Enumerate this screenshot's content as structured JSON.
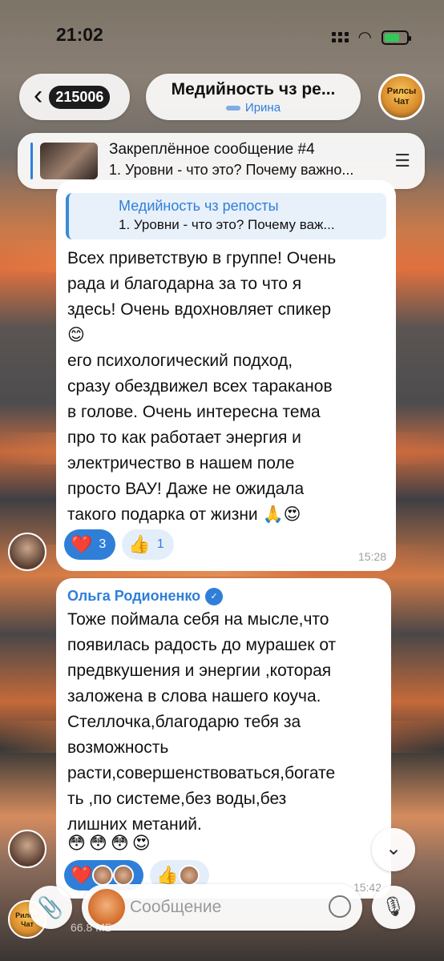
{
  "status": {
    "time": "21:02"
  },
  "header": {
    "back_badge": "215006",
    "title": "Медийность чз ре...",
    "subtitle": "Ирина",
    "avatar_text": "Рилсы Чат"
  },
  "pinned": {
    "title": "Закреплённое сообщение #4",
    "text": "1. Уровни - что это? Почему важно..."
  },
  "messages": [
    {
      "quote_title": "Медийность чз репосты",
      "quote_text": "1. Уровни - что это? Почему важ...",
      "text": "Всех приветствую в группе! Очень\nрада и благодарна за то что я\nздесь! Очень вдохновляет спикер\n😊\nего психологический подход,\nсразу обездвижел всех тараканов\nв голове. Очень интересна тема\nпро то как работает энергия и\nэлектричество в нашем поле\nпросто ВАУ! Даже не ожидала\nтакого подарка от жизни 🙏😍",
      "reactions": [
        {
          "emoji": "❤️",
          "count": "3"
        },
        {
          "emoji": "👍",
          "count": "1"
        }
      ],
      "time": "15:28"
    },
    {
      "sender": "Ольга Родионенко",
      "text": "Тоже поймала себя на мысле,что\nпоявилась радость до мурашек от\nпредвкушения и энергии ,которая\nзаложена в слова нашего коуча.\nСтеллочка,благодарю тебя за\nвозможность\nрасти,совершенствоваться,богате\nть ,по системе,без воды,без\nлишних метаний.",
      "emoji_line": "😳😳😳😍",
      "reactions": [
        {
          "emoji": "❤️"
        },
        {
          "emoji": "👍"
        }
      ],
      "time": "15:42"
    }
  ],
  "composer": {
    "placeholder": "Сообщение"
  },
  "background_file": {
    "size": "66.8 МБ"
  },
  "colors": {
    "accent": "#2f7fd9",
    "bubble": "#ffffff"
  }
}
